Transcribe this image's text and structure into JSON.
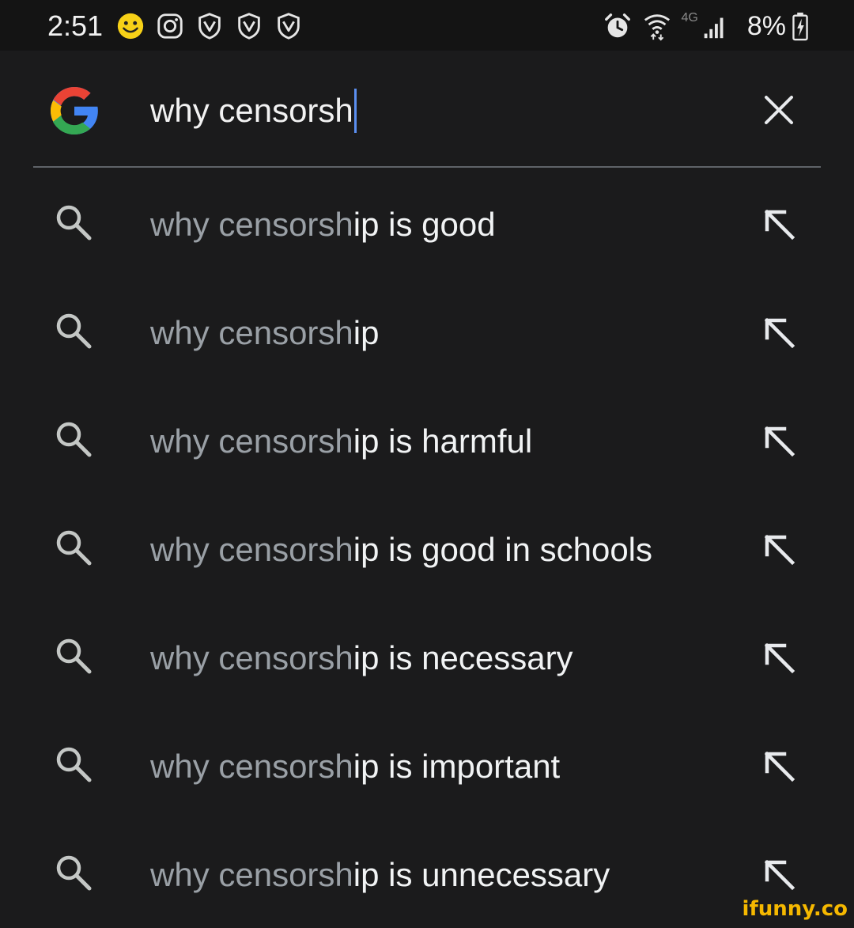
{
  "status_bar": {
    "time": "2:51",
    "network_label": "4G",
    "battery_percent": "8%",
    "left_icons": [
      "emoji-icon",
      "instagram-icon",
      "app-notification-icon",
      "app-notification-icon",
      "app-notification-icon"
    ],
    "right_icons": [
      "alarm-icon",
      "wifi-icon",
      "signal-icon",
      "battery-charging-icon"
    ]
  },
  "search": {
    "query": "why censorsh",
    "logo": "google-g-logo",
    "clear_icon": "close-icon"
  },
  "suggestions": [
    {
      "typed": "why censorsh",
      "completion": "ip is good"
    },
    {
      "typed": "why censorsh",
      "completion": "ip"
    },
    {
      "typed": "why censorsh",
      "completion": "ip is harmful"
    },
    {
      "typed": "why censorsh",
      "completion": "ip is good in schools"
    },
    {
      "typed": "why censorsh",
      "completion": "ip is necessary"
    },
    {
      "typed": "why censorsh",
      "completion": "ip is important"
    },
    {
      "typed": "why censorsh",
      "completion": "ip is unnecessary"
    }
  ],
  "watermark": "ifunny.co",
  "colors": {
    "background": "#1b1b1c",
    "status_bar": "#141414",
    "typed_text": "#9aa0a6",
    "completion_text": "#f1f3f4",
    "caret": "#5b8ff0",
    "watermark": "#f5b800",
    "google_blue": "#4285f4",
    "google_red": "#ea4335",
    "google_yellow": "#fbbc05",
    "google_green": "#34a853"
  }
}
